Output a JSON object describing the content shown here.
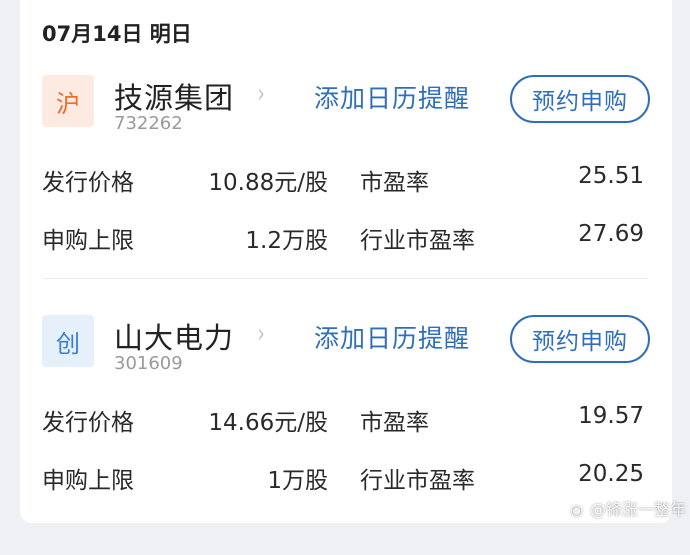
{
  "date_header": "07月14日 明日",
  "stocks": [
    {
      "badge": "沪",
      "badge_color": "#f26b2a",
      "badge_bg": "#fdebe1",
      "name": "技源集团",
      "code": "732262",
      "calendar_link": "添加日历提醒",
      "reserve_button": "预约申购",
      "rows": [
        {
          "label1": "发行价格",
          "value1": "10.88元/股",
          "label2": "市盈率",
          "value2": "25.51"
        },
        {
          "label1": "申购上限",
          "value1": "1.2万股",
          "label2": "行业市盈率",
          "value2": "27.69"
        }
      ]
    },
    {
      "badge": "创",
      "badge_color": "#3a7fd1",
      "badge_bg": "#e6f0fb",
      "name": "山大电力",
      "code": "301609",
      "calendar_link": "添加日历提醒",
      "reserve_button": "预约申购",
      "rows": [
        {
          "label1": "发行价格",
          "value1": "14.66元/股",
          "label2": "市盈率",
          "value2": "19.57"
        },
        {
          "label1": "申购上限",
          "value1": "1万股",
          "label2": "行业市盈率",
          "value2": "20.25"
        }
      ]
    }
  ],
  "watermark": "@锋涨一整年",
  "chevron_icon": "chevron-right-icon",
  "accent_color": "#2f6fba"
}
